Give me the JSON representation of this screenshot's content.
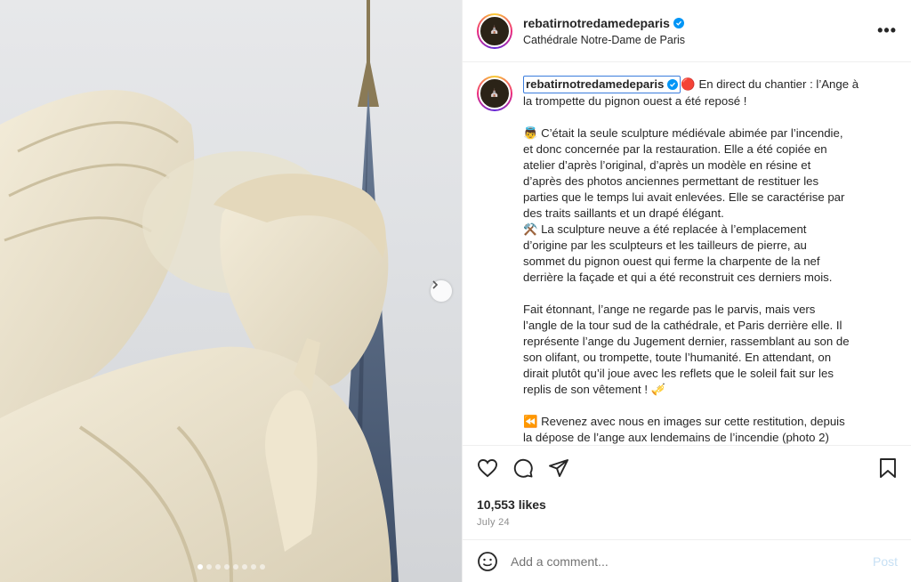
{
  "post": {
    "username": "rebatirnotredamedeparis",
    "location": "Cathédrale Notre-Dame de Paris",
    "avatar_text": "⛪",
    "more_icon": "more-horizontal-icon",
    "carousel_dots": 8,
    "carousel_active": 0
  },
  "caption": {
    "username": "rebatirnotredamedeparis",
    "paragraphs": [
      [
        "🔴 En direct du chantier : l’Ange à",
        "la trompette du pignon ouest a été reposé !"
      ],
      [
        "👼 C’était la seule sculpture médiévale abimée par l’incendie,",
        "et donc concernée par la restauration. Elle a été copiée en",
        "atelier d’après l’original, d’après un modèle en résine et",
        "d’après des photos anciennes permettant de restituer les",
        "parties que le temps lui avait enlevées. Elle se caractérise par",
        "des traits saillants et un drapé élégant.",
        "⚒️ La sculpture neuve a été replacée à l’emplacement",
        "d’origine par les sculpteurs et les tailleurs de pierre, au",
        "sommet du pignon ouest qui ferme la charpente de la nef",
        "derrière la façade et qui a été reconstruit ces derniers mois."
      ],
      [
        "Fait étonnant, l’ange ne regarde pas le parvis, mais vers",
        "l’angle de la tour sud de la cathédrale, et Paris derrière elle. Il",
        "représente l’ange du Jugement dernier, rassemblant au son de",
        "son olifant, ou trompette, toute l’humanité. En attendant, on",
        "dirait plutôt qu’il joue avec les reflets que le soleil fait sur les",
        "replis de son vêtement ! 🎺"
      ],
      [
        "⏪ Revenez avec nous en images sur cette restitution, depuis",
        "la dépose de l’ange aux lendemains de l’incendie (photo 2)"
      ]
    ]
  },
  "engagement": {
    "likes": "10,553 likes",
    "date": "July 24"
  },
  "comment": {
    "placeholder": "Add a comment...",
    "post_label": "Post"
  },
  "colors": {
    "verified": "#0095f6",
    "post_disabled": "#c7e0f4",
    "secondary_text": "#8e8e8e"
  }
}
